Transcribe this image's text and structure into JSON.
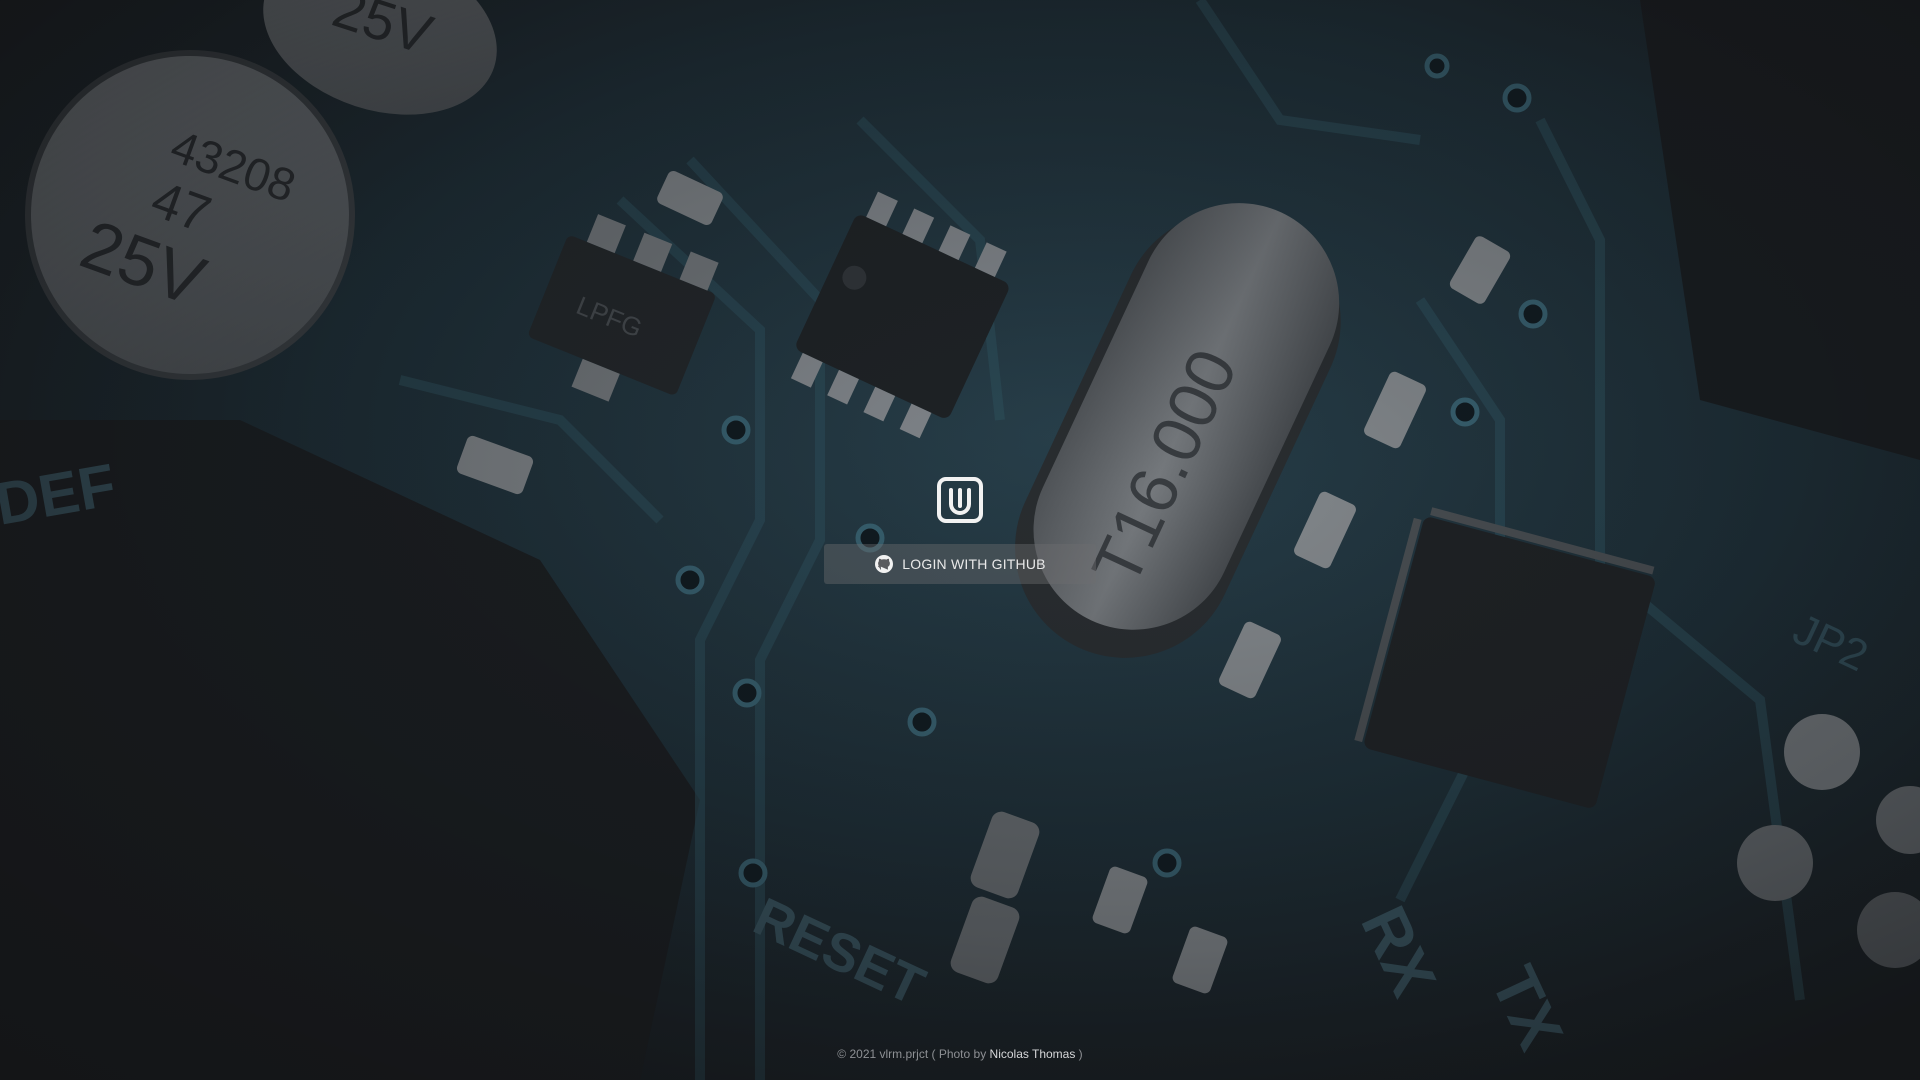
{
  "login": {
    "button_label": "LOGIN WITH GITHUB",
    "button_icon": "github-icon",
    "logo_icon": "app-logo-icon"
  },
  "footer": {
    "prefix": "© 2021 vlrm.prjct ( Photo by ",
    "photographer": "Nicolas Thomas",
    "suffix": " )"
  },
  "background": {
    "photo_text": {
      "cap_top": "25V",
      "cap_code": "43208",
      "cap_value": "47",
      "cap_voltage": "25V",
      "chip_marking": "LPFG",
      "crystal": "T16.000",
      "jumper": "JP2",
      "rx": "RX",
      "tx": "TX",
      "reset": "RESET",
      "pcb_edge": "DEF"
    }
  },
  "colors": {
    "background": "#1a1c1f",
    "pcb": "#1f3540",
    "button_bg": "#6e6e70",
    "text": "#e9e9e9"
  }
}
